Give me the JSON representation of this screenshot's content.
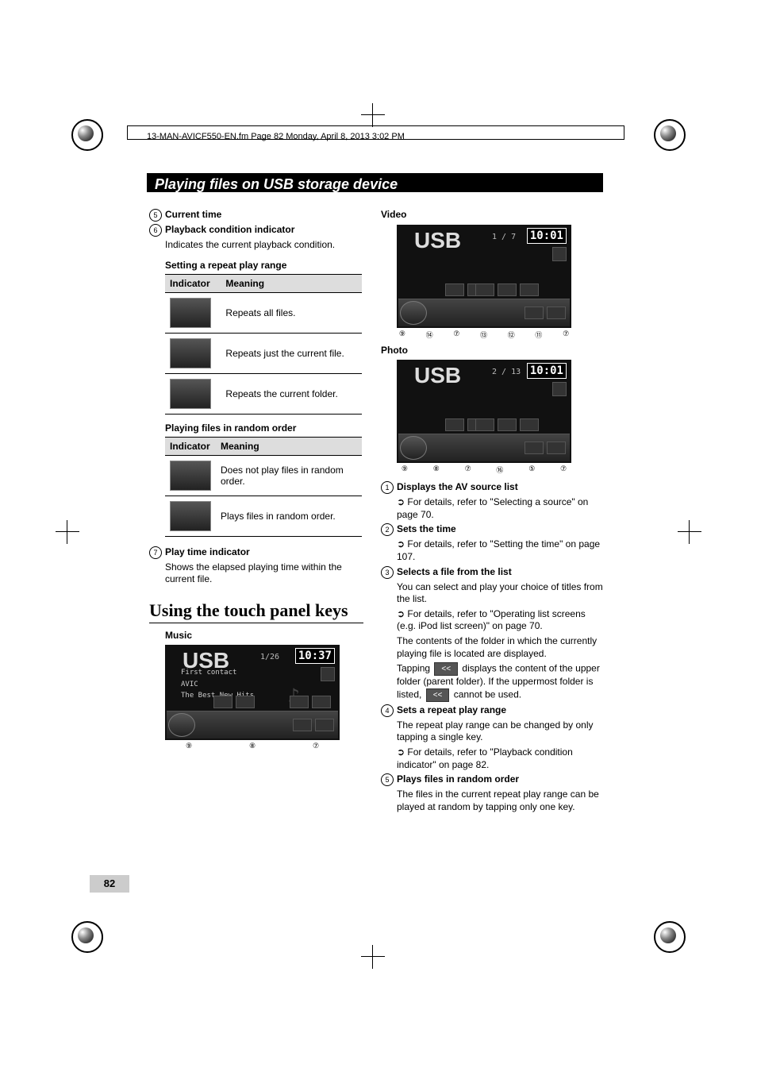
{
  "header": "13-MAN-AVICF550-EN.fm  Page 82  Monday, April 8, 2013  3:02 PM",
  "chapter_title": "Playing files on USB storage device",
  "page_number": "82",
  "left": {
    "item5_title": "Current time",
    "item6_title": "Playback condition indicator",
    "item6_desc": "Indicates the current playback condition.",
    "table1_caption": "Setting a repeat play range",
    "table_headers": {
      "c1": "Indicator",
      "c2": "Meaning"
    },
    "table1": [
      {
        "meaning": "Repeats all files."
      },
      {
        "meaning": "Repeats just the current file."
      },
      {
        "meaning": "Repeats the current folder."
      }
    ],
    "table2_caption": "Playing files in random order",
    "table2": [
      {
        "meaning": "Does not play files in random order."
      },
      {
        "meaning": "Plays files in random order."
      }
    ],
    "item7_title": "Play time indicator",
    "item7_desc": "Shows the elapsed playing time within the current file.",
    "h2": "Using the touch panel keys",
    "music_label": "Music",
    "music_screen": {
      "source": "USB",
      "counter": "1/26",
      "time": "10:37",
      "list": [
        "First contact",
        "AVIC",
        "The Best New Hits"
      ]
    }
  },
  "right": {
    "video_label": "Video",
    "video_screen": {
      "source": "USB",
      "counter": "1 / 7",
      "time": "10:01"
    },
    "photo_label": "Photo",
    "photo_screen": {
      "source": "USB",
      "counter": "2 / 13",
      "time": "10:01"
    },
    "item1_title": "Displays the AV source list",
    "item1_desc": "For details, refer to \"Selecting a source\" on page 70.",
    "item2_title": "Sets the time",
    "item2_desc": "For details, refer to \"Setting the time\" on page 107.",
    "item3_title": "Selects a file from the list",
    "item3_desc1": "You can select and play your choice of titles from the list.",
    "item3_desc2": "For details, refer to \"Operating list screens (e.g. iPod list screen)\" on page 70.",
    "item3_desc3": "The contents of the folder in which the currently playing file is located are displayed.",
    "item3_desc4a": "Tapping ",
    "item3_desc4b": " displays the content of the upper folder (parent folder). If the uppermost folder is listed, ",
    "item3_desc4c": " cannot be used.",
    "back_btn": "<<",
    "item4_title": "Sets a repeat play range",
    "item4_desc1": "The repeat play range can be changed by only tapping a single key.",
    "item4_desc2": "For details, refer to \"Playback condition indicator\" on page 82.",
    "item5_title": "Plays files in random order",
    "item5_desc": "The files in the current repeat play range can be played at random by tapping only one key."
  }
}
